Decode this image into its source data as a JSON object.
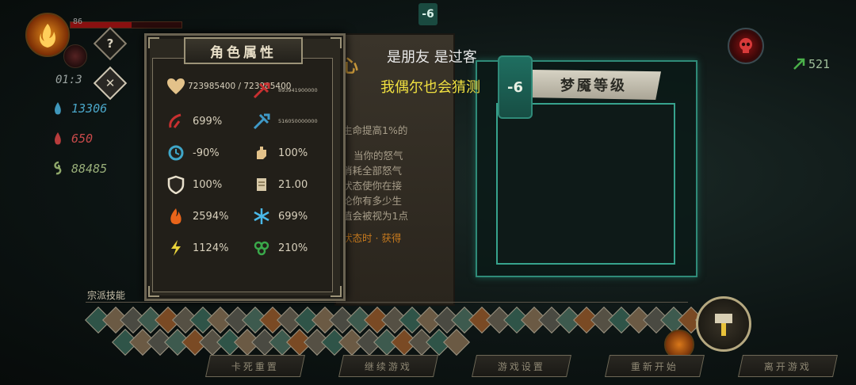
{
  "hud": {
    "level": "86",
    "timer": "01:3",
    "stats": [
      {
        "icon": "blue-flame-icon",
        "value": "13306",
        "color": "#4aa6c8"
      },
      {
        "icon": "red-flame-icon",
        "value": "650",
        "color": "#c84a4a"
      },
      {
        "icon": "green-swirl-icon",
        "value": "88485",
        "color": "#9ab07a"
      }
    ],
    "help_label": "?",
    "close_label": "✕",
    "health_fraction": 0.55
  },
  "top_tag": "-6",
  "cells": "521",
  "attr_panel": {
    "title": "角色属性",
    "items": [
      {
        "icon": "heart-icon",
        "value": "723985400 / 723985400",
        "size": "small"
      },
      {
        "icon": "red-crossbow-icon",
        "value": "893941900000",
        "size": "tiny"
      },
      {
        "icon": "red-whip-icon",
        "value": "699%",
        "size": "normal"
      },
      {
        "icon": "blue-crossbow-icon",
        "value": "516050000000",
        "size": "tiny"
      },
      {
        "icon": "cooldown-icon",
        "value": "-90%",
        "size": "normal"
      },
      {
        "icon": "fist-icon",
        "value": "100%",
        "size": "normal"
      },
      {
        "icon": "shield-icon",
        "value": "100%",
        "size": "normal"
      },
      {
        "icon": "scroll-icon",
        "value": "21.00",
        "size": "normal"
      },
      {
        "icon": "fire-icon",
        "value": "2594%",
        "size": "normal"
      },
      {
        "icon": "snowflake-icon",
        "value": "699%",
        "size": "normal"
      },
      {
        "icon": "lightning-icon",
        "value": "1124%",
        "size": "normal"
      },
      {
        "icon": "poison-icon",
        "value": "210%",
        "size": "normal"
      }
    ]
  },
  "info_panel": {
    "heading": "心",
    "lines": [
      "生命提高1%的",
      "当你的怒气",
      "消耗全部怒气",
      "状态使你在接",
      "论你有多少生",
      "值会被视为1点"
    ],
    "footer": "状态时 · 获得"
  },
  "overlay": {
    "line1": "是朋友 是过客",
    "line2": "我偶尔也会猜测"
  },
  "nightmare": {
    "tag": "-6",
    "title": "梦魇等级"
  },
  "sect_skills": {
    "label": "宗派技能",
    "row1_count": 36,
    "row2_count": 20
  },
  "buttons": [
    {
      "label": "卡死重置"
    },
    {
      "label": "继续游戏"
    },
    {
      "label": "游戏设置"
    },
    {
      "label": "重新开始"
    },
    {
      "label": "离开游戏"
    }
  ]
}
